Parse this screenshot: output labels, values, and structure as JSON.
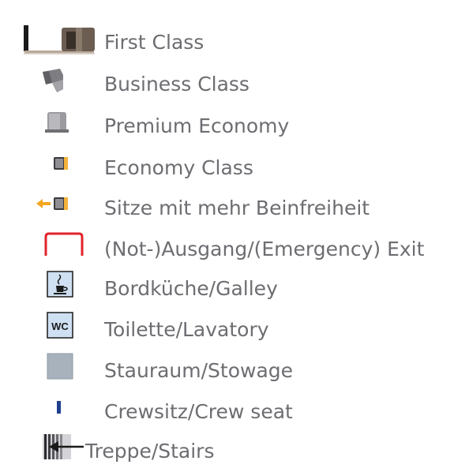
{
  "legend": {
    "items": [
      {
        "icon": "first-class-seat-icon",
        "label": "First Class"
      },
      {
        "icon": "business-class-seat-icon",
        "label": "Business Class"
      },
      {
        "icon": "premium-economy-seat-icon",
        "label": "Premium Economy"
      },
      {
        "icon": "economy-class-seat-icon",
        "label": "Economy Class"
      },
      {
        "icon": "extra-legroom-seat-icon",
        "label": "Sitze mit mehr Beinfreiheit"
      },
      {
        "icon": "exit-icon",
        "label": "(Not-)Ausgang/(Emergency) Exit"
      },
      {
        "icon": "galley-icon",
        "label": "Bordküche/Galley"
      },
      {
        "icon": "lavatory-icon",
        "label": "Toilette/Lavatory",
        "icon_text": "WC"
      },
      {
        "icon": "stowage-icon",
        "label": "Stauraum/Stowage"
      },
      {
        "icon": "crew-seat-icon",
        "label": "Crewsitz/Crew seat"
      },
      {
        "icon": "stairs-icon",
        "label": "Treppe/Stairs"
      }
    ]
  },
  "colors": {
    "text": "#6d6d72",
    "exit": "#e0232b",
    "arrow": "#f5a623",
    "crew": "#1f3f8f",
    "seat_gray": "#8e8e93"
  }
}
